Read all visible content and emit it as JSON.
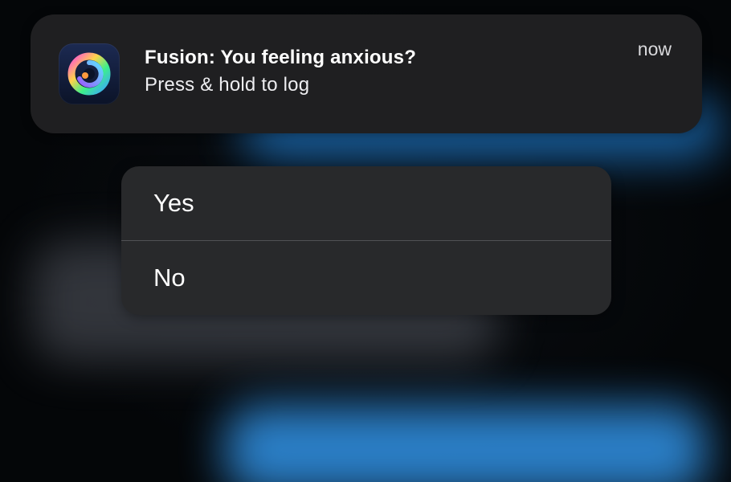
{
  "notification": {
    "app_name_title": "Fusion: You feeling anxious?",
    "body": "Press & hold to log",
    "time": "now",
    "icon": "fusion-app-icon"
  },
  "actions": [
    {
      "label": "Yes"
    },
    {
      "label": "No"
    }
  ],
  "colors": {
    "banner_bg": "#1f1f21",
    "menu_bg": "#28292b",
    "glow_blue": "#2d86d2"
  }
}
